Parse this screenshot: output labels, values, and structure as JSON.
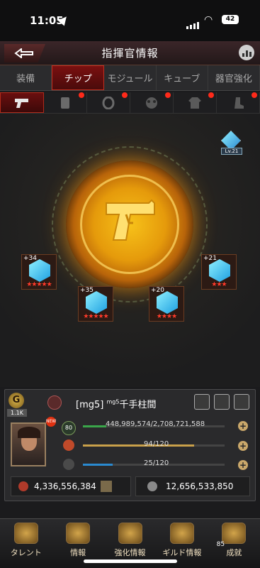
{
  "status": {
    "time": "11:05",
    "battery": "42"
  },
  "header": {
    "title": "指揮官情報"
  },
  "tabs": [
    {
      "label": "装備",
      "active": false
    },
    {
      "label": "チップ",
      "active": true
    },
    {
      "label": "モジュール",
      "active": false
    },
    {
      "label": "キューブ",
      "active": false
    },
    {
      "label": "器官強化",
      "active": false
    }
  ],
  "icon_tabs": [
    {
      "icon": "pistol-icon",
      "active": true,
      "alert": false
    },
    {
      "icon": "vest-icon",
      "active": false,
      "alert": true
    },
    {
      "icon": "rune-icon",
      "active": false,
      "alert": true
    },
    {
      "icon": "gasmask-icon",
      "active": false,
      "alert": true
    },
    {
      "icon": "jacket-icon",
      "active": false,
      "alert": true
    },
    {
      "icon": "boots-icon",
      "active": false,
      "alert": true
    }
  ],
  "arena": {
    "center_icon": "pistol-icon",
    "slot_badge": "Lv.21",
    "chips": [
      {
        "level": "+34",
        "stars": "★★★★★"
      },
      {
        "level": "+35",
        "stars": "★★★★★"
      },
      {
        "level": "+20",
        "stars": "★★★★"
      },
      {
        "level": "+21",
        "stars": "★★★"
      }
    ]
  },
  "profile": {
    "rank_letter": "G",
    "rank_count": "1.1K",
    "name": "[mg5]",
    "name_sup": "mg5",
    "name_main": "千手柱間",
    "new_badge": "NEW",
    "level": "80",
    "exp": "448,989,574/2,708,721,588",
    "exp_fill": 0.166,
    "stamina": "94/120",
    "stamina_fill": 0.783,
    "energy": "25/120",
    "energy_fill": 0.208,
    "power_left": "4,336,556,384",
    "power_right": "12,656,533,850"
  },
  "nav": [
    {
      "label": "タレント"
    },
    {
      "label": "情報"
    },
    {
      "label": "強化情報"
    },
    {
      "label": "ギルド情報"
    },
    {
      "label": "成就",
      "count": "85"
    }
  ]
}
